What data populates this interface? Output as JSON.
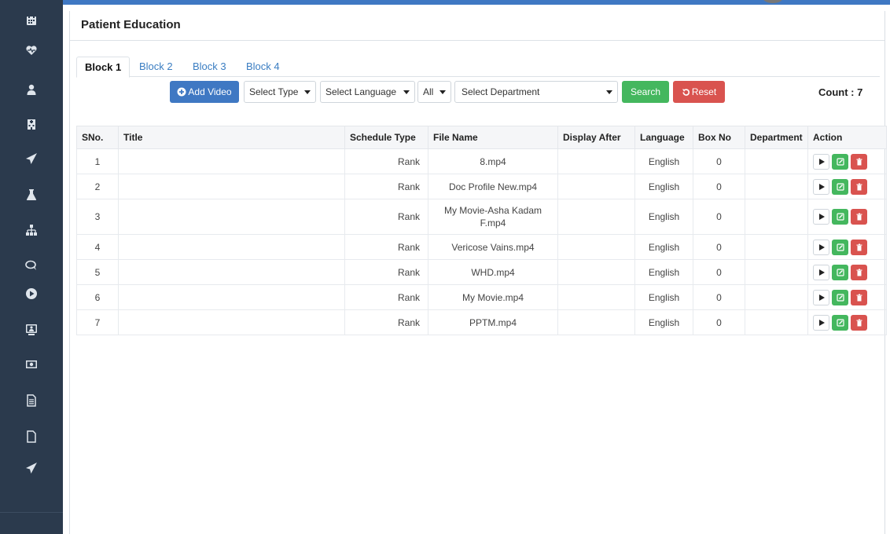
{
  "panel_title": "Patient Education",
  "tabs": [
    {
      "label": "Block 1",
      "active": true
    },
    {
      "label": "Block 2",
      "active": false
    },
    {
      "label": "Block 3",
      "active": false
    },
    {
      "label": "Block 4",
      "active": false
    }
  ],
  "toolbar": {
    "add_video_label": "Add Video",
    "select_type": "Select Type",
    "select_language": "Select Language",
    "select_all": "All",
    "select_department": "Select Department",
    "search_label": "Search",
    "reset_label": "Reset",
    "count_label": "Count : 7"
  },
  "table": {
    "headers": [
      "SNo.",
      "Title",
      "Schedule Type",
      "File Name",
      "Display After",
      "Language",
      "Box No",
      "Department",
      "Action"
    ],
    "rows": [
      {
        "sno": "1",
        "title": "",
        "schedule_type": "Rank",
        "file_name": "8.mp4",
        "display_after": "",
        "language": "English",
        "box_no": "0",
        "department": ""
      },
      {
        "sno": "2",
        "title": "",
        "schedule_type": "Rank",
        "file_name": "Doc Profile New.mp4",
        "display_after": "",
        "language": "English",
        "box_no": "0",
        "department": ""
      },
      {
        "sno": "3",
        "title": "",
        "schedule_type": "Rank",
        "file_name": "My Movie-Asha Kadam F.mp4",
        "display_after": "",
        "language": "English",
        "box_no": "0",
        "department": ""
      },
      {
        "sno": "4",
        "title": "",
        "schedule_type": "Rank",
        "file_name": "Vericose Vains.mp4",
        "display_after": "",
        "language": "English",
        "box_no": "0",
        "department": ""
      },
      {
        "sno": "5",
        "title": "",
        "schedule_type": "Rank",
        "file_name": "WHD.mp4",
        "display_after": "",
        "language": "English",
        "box_no": "0",
        "department": ""
      },
      {
        "sno": "6",
        "title": "",
        "schedule_type": "Rank",
        "file_name": "My Movie.mp4",
        "display_after": "",
        "language": "English",
        "box_no": "0",
        "department": ""
      },
      {
        "sno": "7",
        "title": "",
        "schedule_type": "Rank",
        "file_name": "PPTM.mp4",
        "display_after": "",
        "language": "English",
        "box_no": "0",
        "department": ""
      }
    ]
  },
  "sidebar_icons": [
    "calendar-icon",
    "heartbeat-icon",
    "user-icon",
    "hospital-icon",
    "paper-plane-icon",
    "flask-icon",
    "sitemap-icon",
    "chat-icon",
    "play-circle-icon",
    "monitor-user-icon",
    "money-icon",
    "document-icon",
    "file-icon",
    "paper-plane-icon"
  ],
  "colors": {
    "sidebar": "#2b3a4d",
    "primary": "#3f78c3",
    "success": "#44b75e",
    "danger": "#d9534f"
  }
}
